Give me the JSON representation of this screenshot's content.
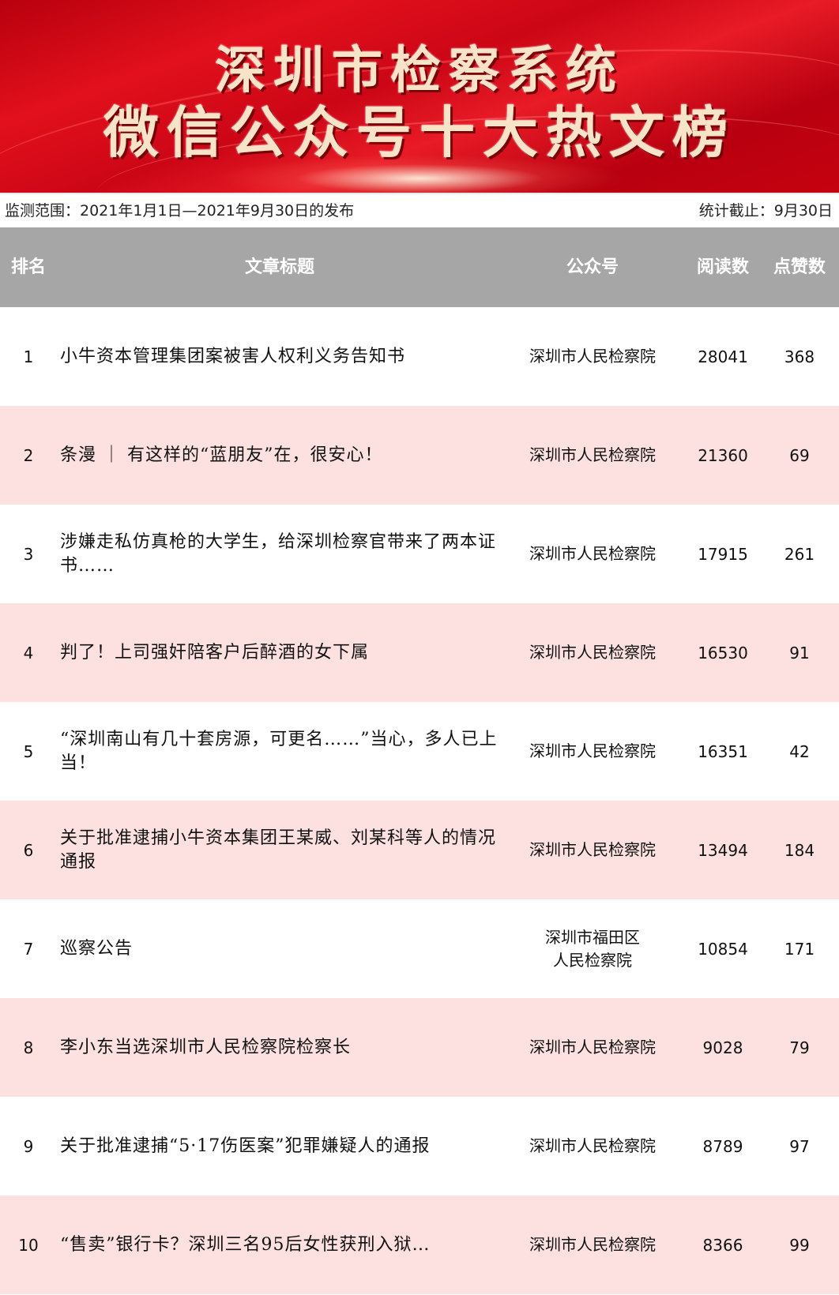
{
  "banner": {
    "line1": "深圳市检察系统",
    "line2": "微信公众号十大热文榜"
  },
  "meta": {
    "range": "监测范围：2021年1月1日—2021年9月30日的发布",
    "cutoff": "统计截止：9月30日"
  },
  "colors": {
    "banner_red": "#d90b18",
    "header_gray": "#a6a6a6",
    "row_pink": "#fde0e0"
  },
  "table": {
    "headers": {
      "rank": "排名",
      "title": "文章标题",
      "account": "公众号",
      "reads": "阅读数",
      "likes": "点赞数"
    },
    "rows": [
      {
        "rank": "1",
        "title": "小牛资本管理集团案被害人权利义务告知书",
        "account": "深圳市人民检察院",
        "reads": "28041",
        "likes": "368"
      },
      {
        "rank": "2",
        "title": "条漫 ｜ 有这样的“蓝朋友”在，很安心！",
        "account": "深圳市人民检察院",
        "reads": "21360",
        "likes": "69"
      },
      {
        "rank": "3",
        "title": "涉嫌走私仿真枪的大学生，给深圳检察官带来了两本证书……",
        "account": "深圳市人民检察院",
        "reads": "17915",
        "likes": "261"
      },
      {
        "rank": "4",
        "title": "判了！上司强奸陪客户后醉酒的女下属",
        "account": "深圳市人民检察院",
        "reads": "16530",
        "likes": "91"
      },
      {
        "rank": "5",
        "title": "“深圳南山有几十套房源，可更名……”当心，多人已上当！",
        "account": "深圳市人民检察院",
        "reads": "16351",
        "likes": "42"
      },
      {
        "rank": "6",
        "title": "关于批准逮捕小牛资本集团王某威、刘某科等人的情况通报",
        "account": "深圳市人民检察院",
        "reads": "13494",
        "likes": "184"
      },
      {
        "rank": "7",
        "title": "巡察公告",
        "account": "深圳市福田区\n人民检察院",
        "reads": "10854",
        "likes": "171"
      },
      {
        "rank": "8",
        "title": "李小东当选深圳市人民检察院检察长",
        "account": "深圳市人民检察院",
        "reads": "9028",
        "likes": "79"
      },
      {
        "rank": "9",
        "title": "关于批准逮捕“5·17伤医案”犯罪嫌疑人的通报",
        "account": "深圳市人民检察院",
        "reads": "8789",
        "likes": "97"
      },
      {
        "rank": "10",
        "title": "“售卖”银行卡？深圳三名95后女性获刑入狱…",
        "account": "深圳市人民检察院",
        "reads": "8366",
        "likes": "99"
      }
    ]
  }
}
